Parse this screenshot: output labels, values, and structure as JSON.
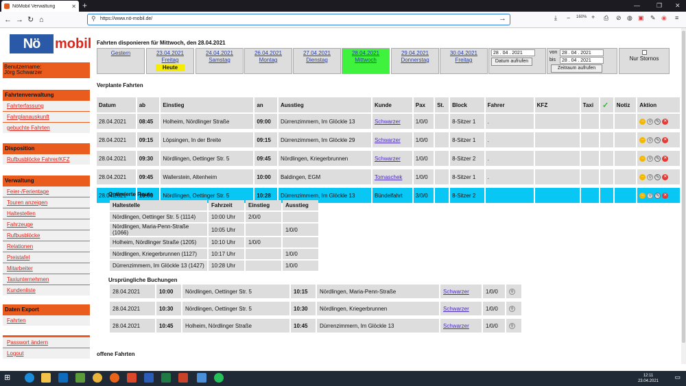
{
  "browser": {
    "tab_title": "NöMobil Verwaltung",
    "url": "https://www.nö-mobil.de/",
    "zoom": "160%"
  },
  "logo": {
    "part1": "Nö",
    "part2": "mobil"
  },
  "user": {
    "label": "Benutzername:",
    "name": "Jörg Schwarzer"
  },
  "sidebar": {
    "fahrten": {
      "head": "Fahrtenverwaltung",
      "items": [
        "Fahrterfassung",
        "Fahrplanauskunft",
        "gebuchte Fahrten"
      ]
    },
    "dispo": {
      "head": "Disposition",
      "items": [
        "Rufbusblöcke Fahrer/KFZ"
      ]
    },
    "verwaltung": {
      "head": "Verwaltung",
      "items": [
        "Feier-/Ferientage",
        "Touren anzeigen",
        "Haltestellen",
        "Fahrzeuge",
        "Rufbusblöcke",
        "Relationen",
        "Preistafel",
        "Mitarbeiter",
        "Taxiunternehmen",
        "Kundenliste"
      ]
    },
    "export": {
      "head": "Daten Export",
      "items": [
        "Fahrten"
      ]
    },
    "misc": {
      "items": [
        "Passwort ändern",
        "Logout"
      ]
    }
  },
  "page_title": "Fahrten disponieren für Mittwoch, den 28.04.2021",
  "days": [
    {
      "l1": "Gestern",
      "l2": ""
    },
    {
      "l1": "23.04.2021",
      "l2": "Freitag",
      "heute": "Heute"
    },
    {
      "l1": "24.04.2021",
      "l2": "Samstag"
    },
    {
      "l1": "26.04.2021",
      "l2": "Montag"
    },
    {
      "l1": "27.04.2021",
      "l2": "Dienstag"
    },
    {
      "l1": "28.04.2021",
      "l2": "Mittwoch"
    },
    {
      "l1": "29.04.2021",
      "l2": "Donnerstag"
    },
    {
      "l1": "30.04.2021",
      "l2": "Freitag"
    }
  ],
  "datefilter": {
    "date": "28 . 04 . 2021",
    "btn": "Datum aufrufen",
    "von_label": "von",
    "von": "28 . 04 . 2021",
    "bis_label": "bis",
    "bis": "28 . 04 . 2021",
    "range_btn": "Zeitraum aufrufen",
    "stornos": "Nur Stornos"
  },
  "section_planned": "Verplante Fahrten",
  "headers": [
    "Datum",
    "ab",
    "Einstieg",
    "an",
    "Ausstieg",
    "Kunde",
    "Pax",
    "St.",
    "Block",
    "Fahrer",
    "KFZ",
    "Taxi",
    "✓",
    "Notiz",
    "Aktion"
  ],
  "rows": [
    [
      "28.04.2021",
      "08:45",
      "Holheim, Nördlinger Straße",
      "09:00",
      "Dürrenzimmern, Im Glöckle 13",
      "Schwarzer",
      "1/0/0",
      "",
      "8-Sitzer 1",
      "."
    ],
    [
      "28.04.2021",
      "09:15",
      "Löpsingen, In der Breite",
      "09:15",
      "Dürrenzimmern, Im Glöckle 29",
      "Schwarzer",
      "1/0/0",
      "",
      "8-Sitzer 1",
      "."
    ],
    [
      "28.04.2021",
      "09:30",
      "Nördlingen, Oettinger Str. 5",
      "09:45",
      "Nördlingen, Kriegerbrunnen",
      "Schwarzer",
      "1/0/0",
      "",
      "8-Sitzer 2",
      "."
    ],
    [
      "28.04.2021",
      "09:45",
      "Wallerstein, Altenheim",
      "10:00",
      "Baldingen, EGM",
      "Tomaschek",
      "1/0/0",
      "",
      "8-Sitzer 1",
      "."
    ],
    [
      "28.04.2021",
      "10:00",
      "Nördlingen, Oettinger Str. 5",
      "10:28",
      "Dürrenzimmern, Im Glöckle 13",
      "Bündelfahrt",
      "3/0/0",
      "",
      "8-Sitzer 2",
      ""
    ]
  ],
  "route": {
    "title": "Optimierte Route",
    "headers": [
      "Haltestelle",
      "Fahrzeit",
      "Einstieg",
      "Ausstieg"
    ],
    "rows": [
      [
        "Nördlingen, Oettinger Str. 5 (1114)",
        "10:00 Uhr",
        "2/0/0",
        ""
      ],
      [
        "Nördlingen, Maria-Penn-Straße (1066)",
        "10:05 Uhr",
        "",
        "1/0/0"
      ],
      [
        "Holheim, Nördlinger Straße (1205)",
        "10:10 Uhr",
        "1/0/0",
        ""
      ],
      [
        "Nördlingen, Kriegerbrunnen (1127)",
        "10:17 Uhr",
        "",
        "1/0/0"
      ],
      [
        "Dürrenzimmern, Im Glöckle 13 (1427)",
        "10:28 Uhr",
        "",
        "1/0/0"
      ]
    ]
  },
  "bookings": {
    "title": "Ursprüngliche Buchungen",
    "rows": [
      [
        "28.04.2021",
        "10:00",
        "Nördlingen, Oettinger Str. 5",
        "10:15",
        "Nördlingen, Maria-Penn-Straße",
        "Schwarzer",
        "1/0/0"
      ],
      [
        "28.04.2021",
        "10:30",
        "Nördlingen, Oettinger Str. 5",
        "10:30",
        "Nördlingen, Kriegerbrunnen",
        "Schwarzer",
        "1/0/0"
      ],
      [
        "28.04.2021",
        "10:45",
        "Holheim, Nördlinger Straße",
        "10:45",
        "Dürrenzimmern, Im Glöckle 13",
        "Schwarzer",
        "1/0/0"
      ]
    ]
  },
  "section_open": "offene Fahrten",
  "clock": {
    "time": "12:11",
    "date": "23.04.2021"
  }
}
